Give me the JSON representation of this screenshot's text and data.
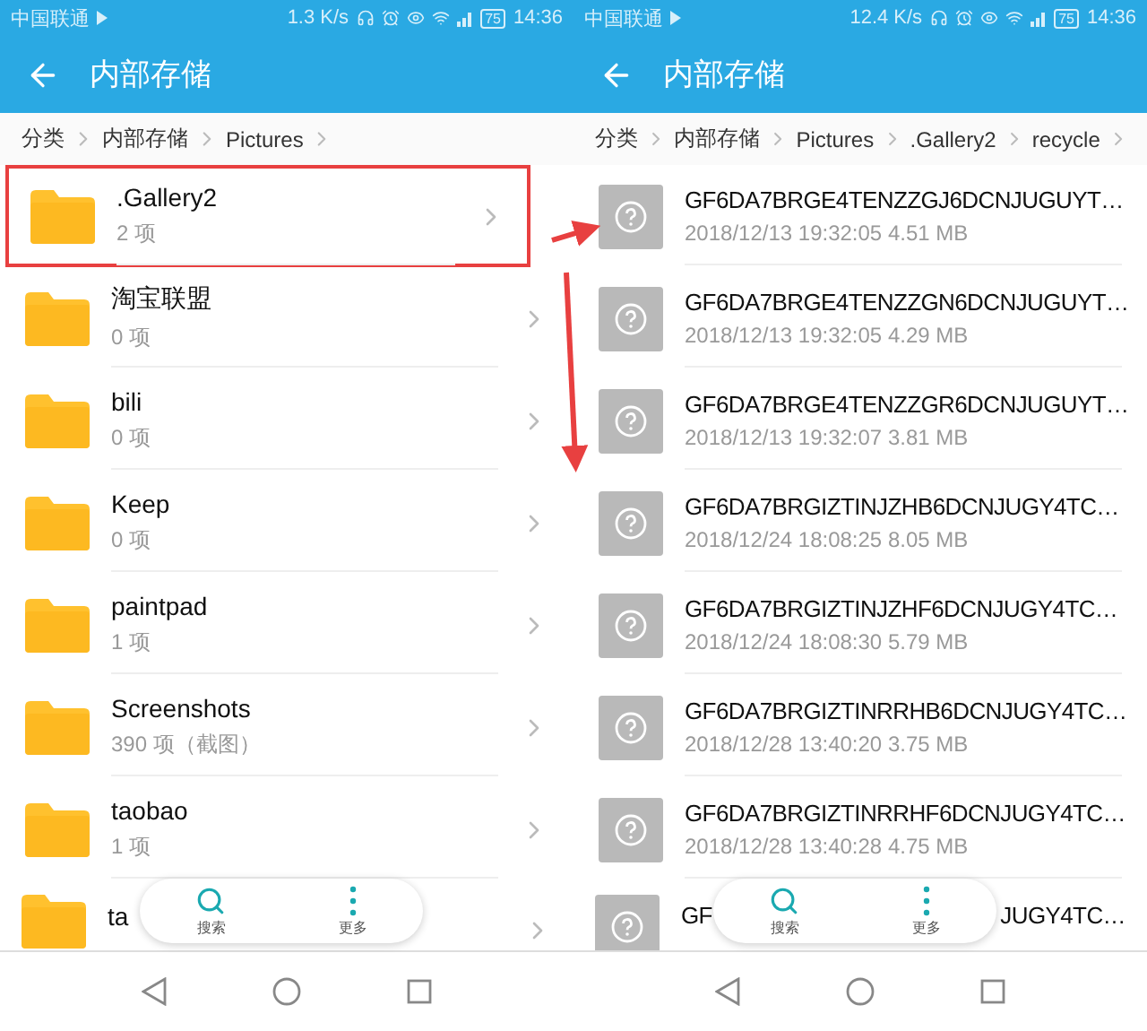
{
  "panels": [
    {
      "status_bar": {
        "carrier": "中国联通",
        "speed": "1.3 K/s",
        "battery": "75",
        "time": "14:36"
      },
      "title": "内部存储",
      "breadcrumbs": [
        "分类",
        "内部存储",
        "Pictures"
      ],
      "items": [
        {
          "kind": "folder",
          "name": ".Gallery2",
          "detail": "2 项",
          "highlighted": true
        },
        {
          "kind": "folder",
          "name": "淘宝联盟",
          "detail": "0 项",
          "highlighted": false
        },
        {
          "kind": "folder",
          "name": "bili",
          "detail": "0 项",
          "highlighted": false
        },
        {
          "kind": "folder",
          "name": "Keep",
          "detail": "0 项",
          "highlighted": false
        },
        {
          "kind": "folder",
          "name": "paintpad",
          "detail": "1 项",
          "highlighted": false
        },
        {
          "kind": "folder",
          "name": "Screenshots",
          "detail": "390 项（截图）",
          "highlighted": false
        },
        {
          "kind": "folder",
          "name": "taobao",
          "detail": "1 项",
          "highlighted": false
        },
        {
          "kind": "covered_folder",
          "parts": [
            "ta"
          ]
        }
      ],
      "toolbar": [
        {
          "kind": "search",
          "label": "搜索"
        },
        {
          "kind": "more",
          "label": "更多"
        }
      ]
    },
    {
      "status_bar": {
        "carrier": "中国联通",
        "speed": "12.4 K/s",
        "battery": "75",
        "time": "14:36"
      },
      "title": "内部存储",
      "breadcrumbs": [
        "分类",
        "内部存储",
        "Pictures",
        ".Gallery2",
        "recycle"
      ],
      "items": [
        {
          "kind": "file",
          "name": "GF6DA7BRGE4TENZZGJ6DCNJUGUYT…",
          "detail": "2018/12/13 19:32:05 4.51 MB",
          "highlighted": false
        },
        {
          "kind": "file",
          "name": "GF6DA7BRGE4TENZZGN6DCNJUGUYT…",
          "detail": "2018/12/13 19:32:05 4.29 MB",
          "highlighted": false
        },
        {
          "kind": "file",
          "name": "GF6DA7BRGE4TENZZGR6DCNJUGUYT…",
          "detail": "2018/12/13 19:32:07 3.81 MB",
          "highlighted": false
        },
        {
          "kind": "file",
          "name": "GF6DA7BRGIZTINJZHB6DCNJUGY4TC…",
          "detail": "2018/12/24 18:08:25 8.05 MB",
          "highlighted": false
        },
        {
          "kind": "file",
          "name": "GF6DA7BRGIZTINJZHF6DCNJUGY4TC…",
          "detail": "2018/12/24 18:08:30 5.79 MB",
          "highlighted": false
        },
        {
          "kind": "file",
          "name": "GF6DA7BRGIZTINRRHB6DCNJUGY4TC…",
          "detail": "2018/12/28 13:40:20 3.75 MB",
          "highlighted": false
        },
        {
          "kind": "file",
          "name": "GF6DA7BRGIZTINRRHF6DCNJUGY4TC…",
          "detail": "2018/12/28 13:40:28 4.75 MB",
          "highlighted": false
        },
        {
          "kind": "covered_file",
          "parts": [
            "GF",
            "JUGY4TC…"
          ]
        }
      ],
      "toolbar": [
        {
          "kind": "search",
          "label": "搜索"
        },
        {
          "kind": "more",
          "label": "更多"
        }
      ]
    }
  ]
}
